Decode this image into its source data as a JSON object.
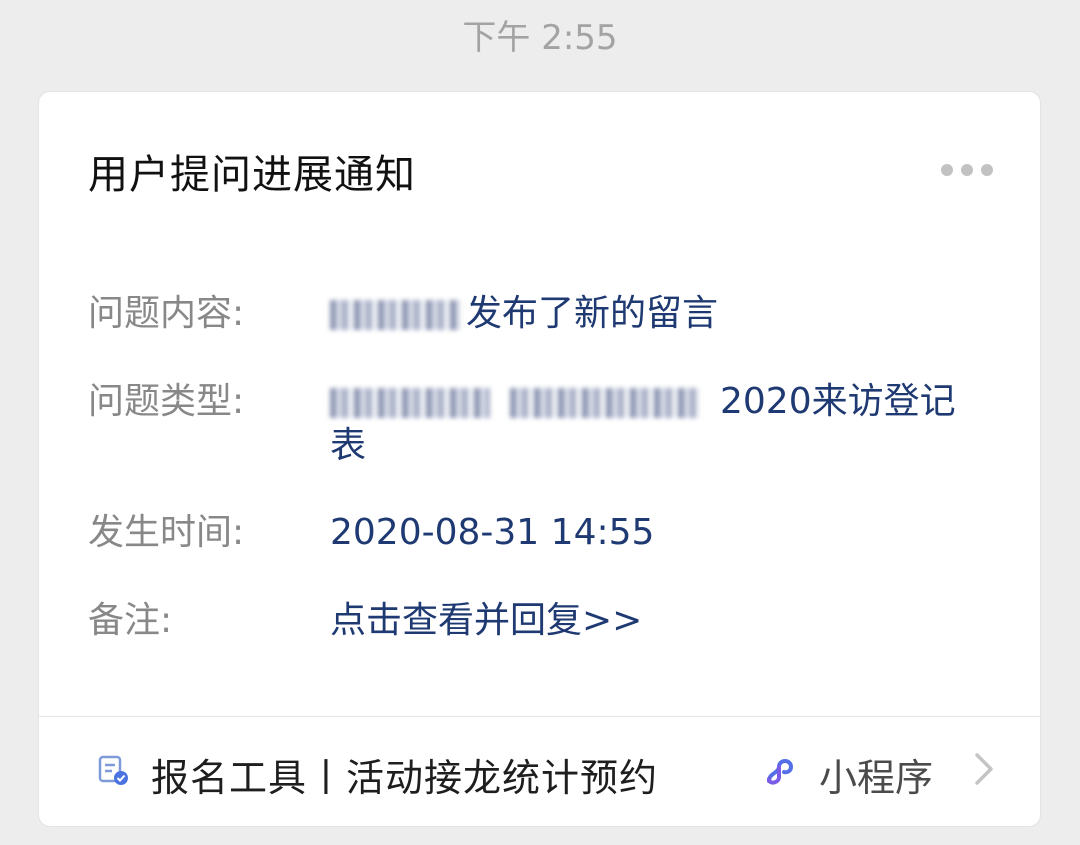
{
  "status": {
    "time": "下午 2:55"
  },
  "card": {
    "title": "用户提问进展通知",
    "fields": [
      {
        "label": "问题内容:",
        "value": "发布了新的留言"
      },
      {
        "label": "问题类型:",
        "value_line1": "2020来访登记",
        "value_line2": "表"
      },
      {
        "label": "发生时间:",
        "value": "2020-08-31 14:55"
      },
      {
        "label": "备注:",
        "value": "点击查看并回复>>"
      }
    ]
  },
  "footer": {
    "app_name": "报名工具丨活动接龙统计预约",
    "mini_program_label": "小程序",
    "icons": [
      "document-check-icon",
      "mini-program-icon",
      "chevron-right-icon"
    ]
  },
  "colors": {
    "background": "#ededed",
    "card": "#ffffff",
    "label": "#888888",
    "value": "#1f3a72",
    "accent_blue": "#4a72e0"
  }
}
